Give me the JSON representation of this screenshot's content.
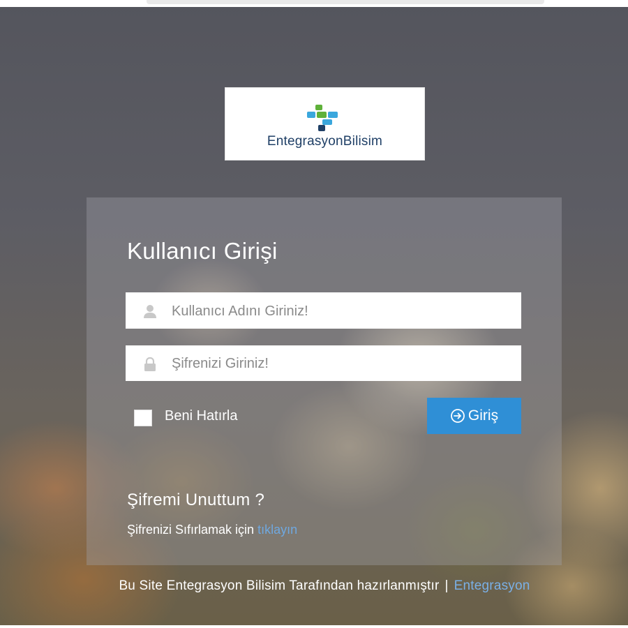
{
  "brand": {
    "logo_text": "EntegrasyonBilisim",
    "colors": {
      "dark_blue": "#1f3f66",
      "light_blue": "#3aa7dd",
      "green": "#5fb13a"
    }
  },
  "login": {
    "title": "Kullanıcı Girişi",
    "username": {
      "placeholder": "Kullanıcı Adını Giriniz!",
      "value": "",
      "icon": "user-icon"
    },
    "password": {
      "placeholder": "Şifrenizi Giriniz!",
      "value": "",
      "icon": "lock-icon"
    },
    "remember_label": "Beni Hatırla",
    "remember_checked": false,
    "submit_label": "Giriş",
    "submit_icon": "arrow-circle-right-icon",
    "submit_color": "#2f8fd6"
  },
  "forgot": {
    "title": "Şifremi Unuttum ?",
    "text": "Şifrenizi Sıfırlamak için",
    "link_label": "tıklayın",
    "link_color": "#6fa8e0"
  },
  "footer": {
    "text": "Bu Site Entegrasyon Bilisim Tarafından hazırlanmıştır",
    "separator": "|",
    "link_label": "Entegrasyon"
  }
}
